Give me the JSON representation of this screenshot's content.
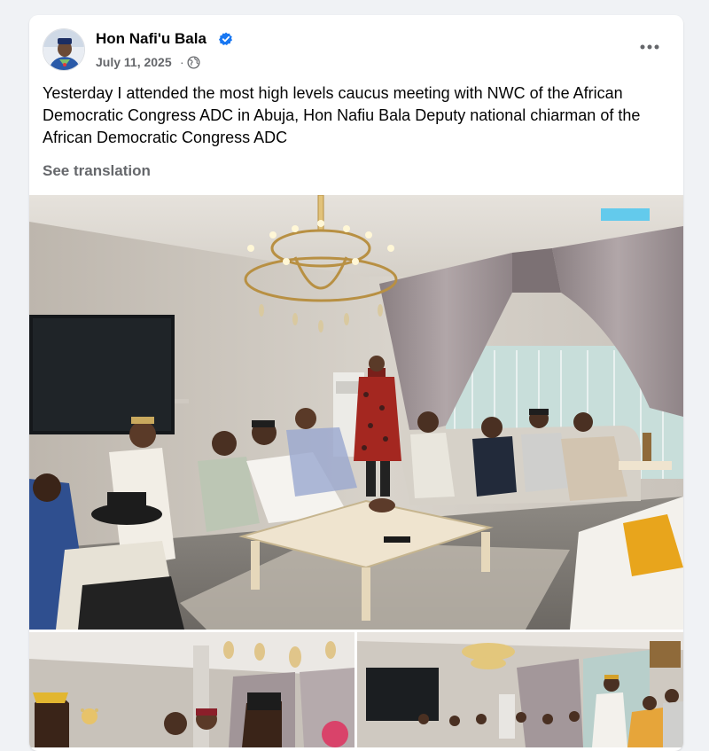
{
  "post": {
    "author": "Hon Nafi'u Bala",
    "date": "July 11, 2025",
    "separator": "·",
    "verified_icon": "verified-badge-icon",
    "audience_icon": "globe-icon",
    "more_icon": "more-options-icon",
    "text": "Yesterday I attended the most high levels caucus meeting with NWC of the African Democratic Congress ADC in Abuja, Hon Nafiu Bala Deputy national chiarman of the African Democratic Congress ADC",
    "see_translation": "See translation"
  },
  "colors": {
    "background": "#f0f2f5",
    "card": "#ffffff",
    "primary_text": "#050505",
    "secondary_text": "#65676b",
    "verified_blue": "#1877f2"
  }
}
